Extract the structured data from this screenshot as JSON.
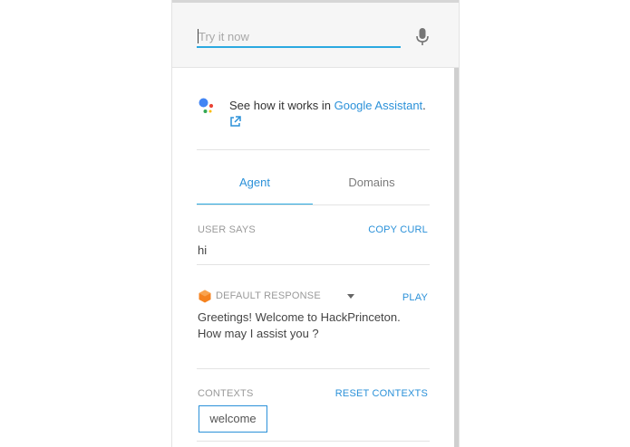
{
  "search": {
    "placeholder": "Try it now",
    "value": ""
  },
  "icons": {
    "mic": "microphone-icon",
    "assistant": "google-assistant-icon",
    "external": "external-link-icon",
    "response": "hexagon-icon",
    "dropdown": "caret-down-icon"
  },
  "assistant": {
    "prefix": "See how it works in ",
    "link_label": "Google Assistant",
    "suffix": "."
  },
  "tabs": [
    {
      "label": "Agent",
      "active": true
    },
    {
      "label": "Domains",
      "active": false
    }
  ],
  "user_says": {
    "label": "USER SAYS",
    "action": "COPY CURL",
    "value": "hi"
  },
  "response": {
    "label": "DEFAULT RESPONSE",
    "action": "PLAY",
    "text": "Greetings! Welcome to HackPrinceton. How may I assist you ?"
  },
  "contexts": {
    "label": "CONTEXTS",
    "action": "RESET CONTEXTS",
    "items": [
      "welcome"
    ]
  },
  "colors": {
    "accent": "#2b91d9",
    "underline": "#2ba9e0",
    "hex_icon": "#f5821f"
  }
}
